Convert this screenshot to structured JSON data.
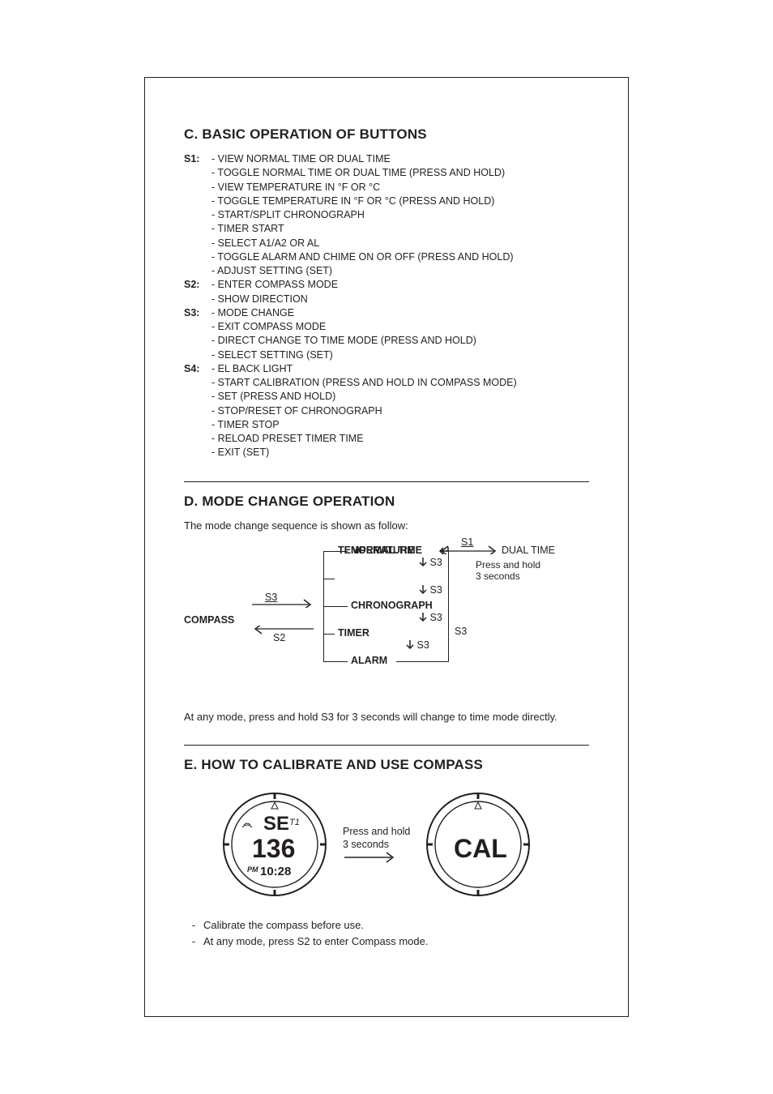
{
  "sectionC": {
    "title": "C. BASIC OPERATION OF BUTTONS",
    "buttons": [
      {
        "label": "S1:",
        "items": [
          "- VIEW NORMAL TIME OR DUAL TIME",
          "- TOGGLE NORMAL TIME OR DUAL TIME (PRESS AND HOLD)",
          "- VIEW TEMPERATURE IN °F OR °C",
          "- TOGGLE TEMPERATURE IN °F OR °C (PRESS AND HOLD)",
          "- START/SPLIT CHRONOGRAPH",
          "- TIMER START",
          "- SELECT A1/A2 OR AL",
          "- TOGGLE ALARM AND CHIME ON OR OFF (PRESS AND HOLD)",
          "- ADJUST SETTING (SET)"
        ]
      },
      {
        "label": "S2:",
        "items": [
          "- ENTER COMPASS MODE",
          "- SHOW DIRECTION"
        ]
      },
      {
        "label": "S3:",
        "items": [
          "- MODE CHANGE",
          "- EXIT COMPASS MODE",
          "- DIRECT CHANGE TO TIME MODE (PRESS AND HOLD)",
          "- SELECT SETTING (SET)"
        ]
      },
      {
        "label": "S4:",
        "items": [
          "- EL BACK LIGHT",
          "- START CALIBRATION (PRESS AND HOLD IN COMPASS MODE)",
          "- SET (PRESS AND HOLD)",
          "- STOP/RESET OF CHRONOGRAPH",
          "- TIMER STOP",
          "- RELOAD PRESET TIMER TIME",
          "- EXIT (SET)"
        ]
      }
    ]
  },
  "sectionD": {
    "title": "D.  MODE CHANGE OPERATION",
    "intro": "The mode change sequence is shown as follow:",
    "modes": {
      "normal": "NORMAL TIME",
      "temperature": "TEMPERATURE",
      "chronograph": "CHRONOGRAPH",
      "timer": "TIMER",
      "alarm": "ALARM",
      "compass": "COMPASS",
      "dual": "DUAL TIME"
    },
    "labels": {
      "S1": "S1",
      "S2": "S2",
      "S3": "S3",
      "press_hold": "Press and hold",
      "three_sec": "3 seconds"
    },
    "note": "At any mode, press and hold S3 for 3 seconds will change to time mode directly."
  },
  "sectionE": {
    "title": "E. HOW TO CALIBRATE AND USE COMPASS",
    "dial_left": {
      "dir": "SE",
      "t1": "T1",
      "deg": "136",
      "pm": "PM",
      "time": "10:28",
      "signal_icon": "signal-icon",
      "triangle_icon": "triangle-icon"
    },
    "arrow_text1": "Press and hold",
    "arrow_text2": "3 seconds",
    "dial_right": {
      "cal": "CAL",
      "triangle_icon": "triangle-icon"
    },
    "bullets": [
      "Calibrate the compass before use.",
      "At any mode, press S2 to enter Compass mode."
    ]
  }
}
